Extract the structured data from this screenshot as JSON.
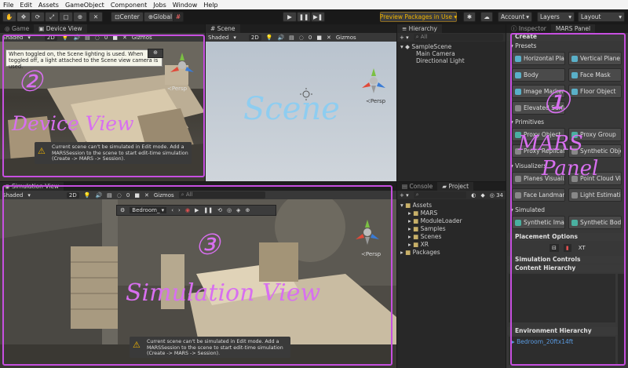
{
  "menubar": [
    "File",
    "Edit",
    "Assets",
    "GameObject",
    "Component",
    "Jobs",
    "Window",
    "Help"
  ],
  "toolbar": {
    "center_label": "Center",
    "global_label": "Global",
    "preview_packages": "Preview Packages in Use ▾",
    "account": "Account",
    "layers": "Layers",
    "layout": "Layout"
  },
  "game_panel": {
    "tabs": [
      "Game",
      "Device View"
    ],
    "shaded": "Shaded",
    "mode_2d": "2D",
    "gizmos": "Gizmos",
    "gizmo_count": "0",
    "tooltip": "When toggled on, the Scene lighting is used. When toggled off, a light attached to the Scene view camera is used.",
    "persp": "≺Persp",
    "warning": "Current scene can't be simulated in Edit mode. Add a MARSSession to the scene to start edit-time simulation (Create -> MARS -> Session)."
  },
  "scene_panel": {
    "tab": "Scene",
    "shaded": "Shaded",
    "mode_2d": "2D",
    "gizmos": "Gizmos",
    "gizmo_count": "0",
    "persp": "≺Persp"
  },
  "sim_panel": {
    "tab": "Simulation View",
    "shaded": "Shaded",
    "mode_2d": "2D",
    "gizmos": "Gizmos",
    "all_placeholder": "All",
    "gizmo_count": "0",
    "environment": "Bedroom_",
    "persp": "≺Persp",
    "warning": "Current scene can't be simulated in Edit mode. Add a MARSSession to the scene to start edit-time simulation (Create -> MARS -> Session)."
  },
  "hierarchy": {
    "tab": "Hierarchy",
    "search_placeholder": "All",
    "scene": "SampleScene",
    "items": [
      "Main Camera",
      "Directional Light"
    ]
  },
  "project": {
    "tabs": [
      "Console",
      "Project"
    ],
    "count": "34",
    "root": "Assets",
    "folders": [
      "MARS",
      "ModuleLoader",
      "Samples",
      "Scenes",
      "XR"
    ],
    "packages": "Packages"
  },
  "inspector": {
    "tabs": [
      "Inspector",
      "MARS Panel"
    ],
    "create": "Create",
    "sections": {
      "presets": "Presets",
      "primitives": "Primitives",
      "visualizers": "Visualizers",
      "simulated": "Simulated"
    },
    "presets": [
      "Horizontal Plane",
      "Vertical Plane",
      "Body",
      "Face Mask",
      "Image Marker",
      "Floor Object",
      "Elevated Surface"
    ],
    "primitives": [
      "Proxy Object",
      "Proxy Group",
      "Proxy Replicator",
      "Synthetic Object"
    ],
    "visualizers": [
      "Planes Visualizer",
      "Point Cloud Visualizer",
      "Face Landmarks",
      "Light Estimation"
    ],
    "simulated": [
      "Synthetic Image",
      "Synthetic Body"
    ],
    "placement_options": "Placement Options",
    "placement_xr": "XT",
    "simulation_controls": "Simulation Controls",
    "content_hierarchy": "Content Hierarchy",
    "environment_hierarchy": "Environment Hierarchy",
    "environment_item": "Bedroom_20ftx14ft"
  },
  "annotations": {
    "device_num": "②",
    "device_text": "Device View",
    "scene_text": "Scene",
    "sim_num": "③",
    "sim_text": "Simulation View",
    "mars_num": "①",
    "mars_text1": "MARS",
    "mars_text2": "Panel"
  },
  "colors": {
    "annotation": "#c74fe0",
    "scene_sky": "#c8d0d8",
    "room": "#5a5750",
    "accent": "#3a7bd5",
    "warning": "#f0b400"
  }
}
